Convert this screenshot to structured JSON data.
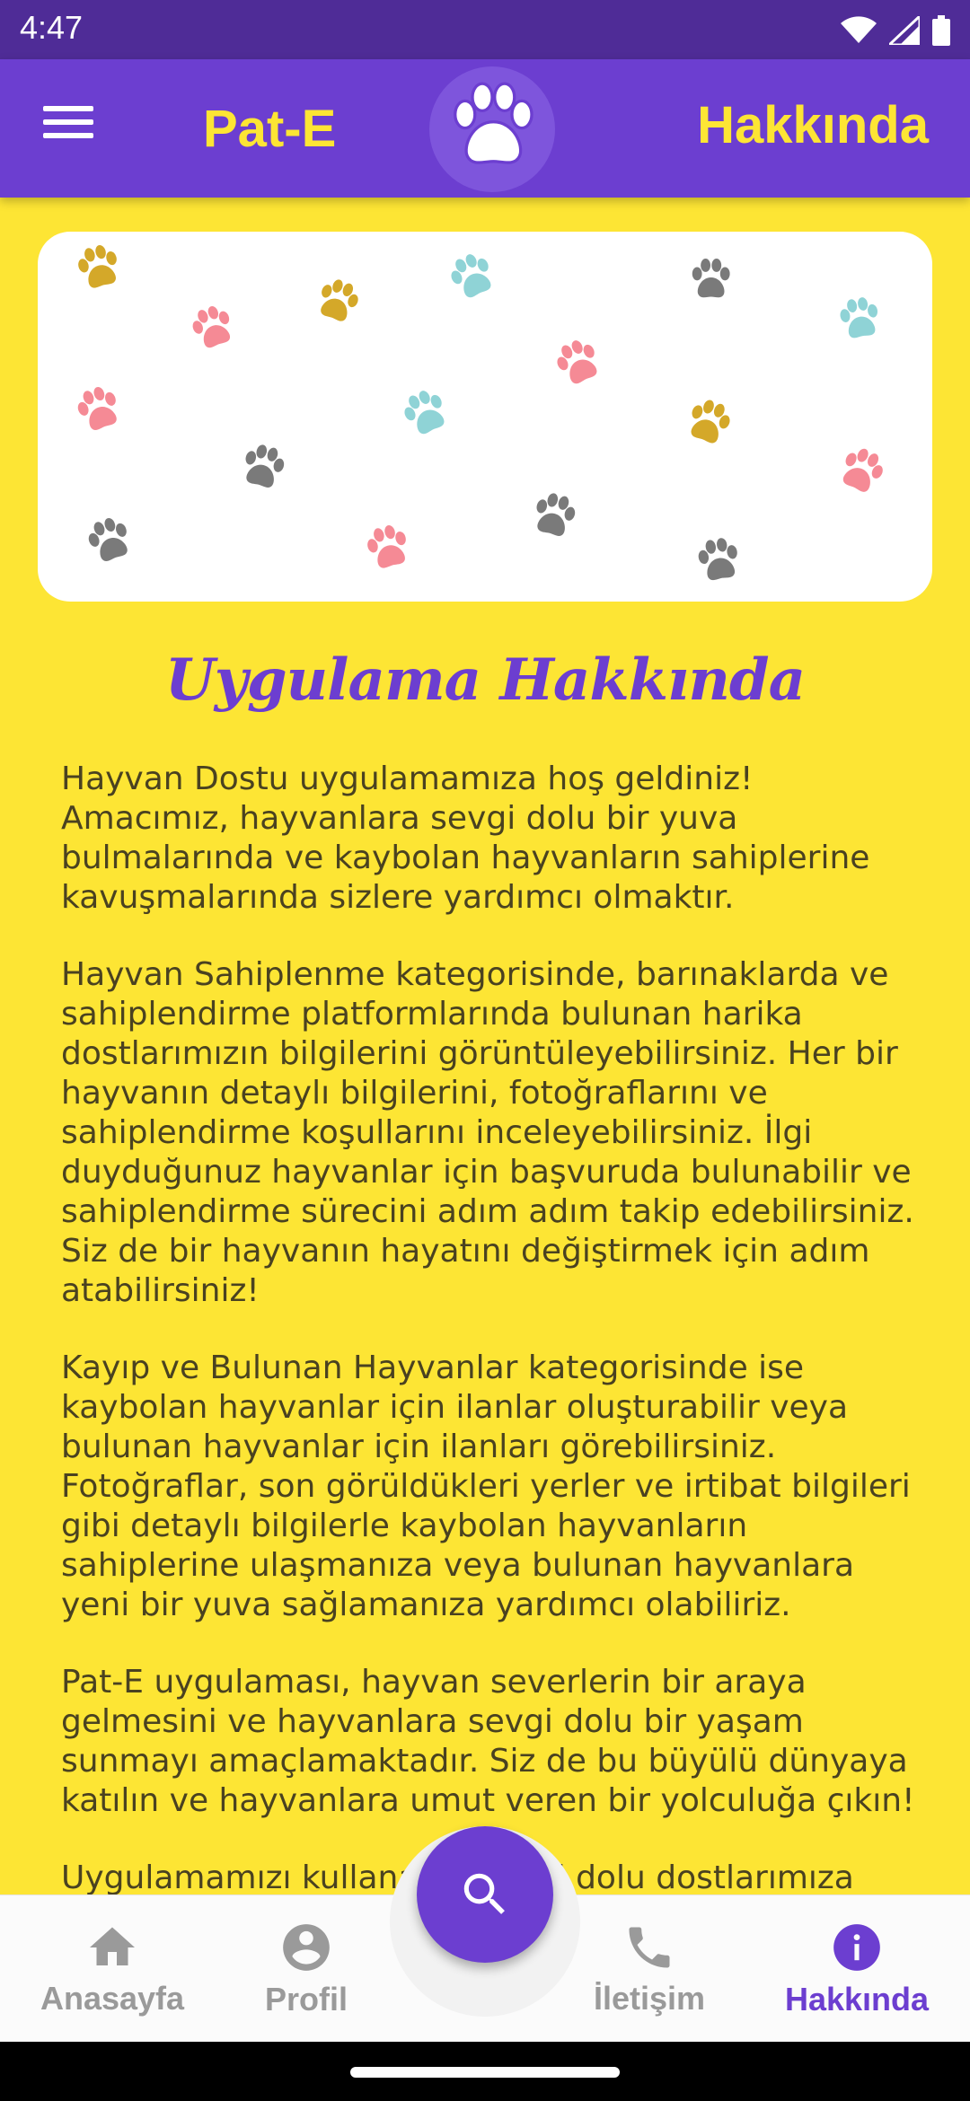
{
  "status_bar": {
    "time": "4:47",
    "icons": [
      "wifi-icon",
      "signal-icon",
      "battery-icon"
    ]
  },
  "app_bar": {
    "title": "Pat-E",
    "page_title": "Hakkında",
    "logo": "paw-logo-icon"
  },
  "about": {
    "title": "Uygulama Hakkında",
    "paragraphs": [
      "Hayvan Dostu uygulamamıza hoş geldiniz! Amacımız, hayvanlara sevgi dolu bir yuva bulmalarında ve kaybolan hayvanların sahiplerine kavuşmalarında sizlere yardımcı olmaktır.",
      "Hayvan Sahiplenme kategorisinde, barınaklarda ve sahiplendirme platformlarında bulunan harika dostlarımızın bilgilerini görüntüleyebilirsiniz. Her bir hayvanın detaylı bilgilerini, fotoğraflarını ve sahiplendirme koşullarını inceleyebilirsiniz. İlgi duyduğunuz hayvanlar için başvuruda bulunabilir ve sahiplendirme sürecini adım adım takip edebilirsiniz. Siz de bir hayvanın hayatını değiştirmek için adım atabilirsiniz!",
      "Kayıp ve Bulunan Hayvanlar kategorisinde ise kaybolan hayvanlar için ilanlar oluşturabilir veya bulunan hayvanlar için ilanları görebilirsiniz. Fotoğraflar, son görüldükleri yerler ve irtibat bilgileri gibi detaylı bilgilerle kaybolan hayvanların sahiplerine ulaşmanıza veya bulunan hayvanlara yeni bir yuva sağlamanıza yardımcı olabiliriz.",
      "Pat-E uygulaması, hayvan severlerin bir araya gelmesini ve hayvanlara sevgi dolu bir yaşam sunmayı amaçlamaktadır. Siz de bu büyülü dünyaya katılın ve hayvanlara umut veren bir yolculuğa çıkın!",
      "Uygulamamızı kullanarak sevgi dolu dostlarımıza yeni"
    ]
  },
  "banner": {
    "paw_colors": [
      "#d4a829",
      "#f58a95",
      "#8fd3d6",
      "#7a7a7a"
    ]
  },
  "bottom_nav": {
    "items": [
      {
        "label": "Anasayfa",
        "icon": "home-icon"
      },
      {
        "label": "Profil",
        "icon": "profile-icon"
      },
      {
        "label": "İletişim",
        "icon": "phone-icon"
      },
      {
        "label": "Hakkında",
        "icon": "info-icon"
      }
    ],
    "active": "Hakkında",
    "fab_icon": "search-icon"
  },
  "colors": {
    "primary": "#6c3ed0",
    "status_bar": "#4f2c97",
    "accent_yellow": "#fde534",
    "body_text": "#4a4220",
    "inactive": "#9a9a9a"
  }
}
